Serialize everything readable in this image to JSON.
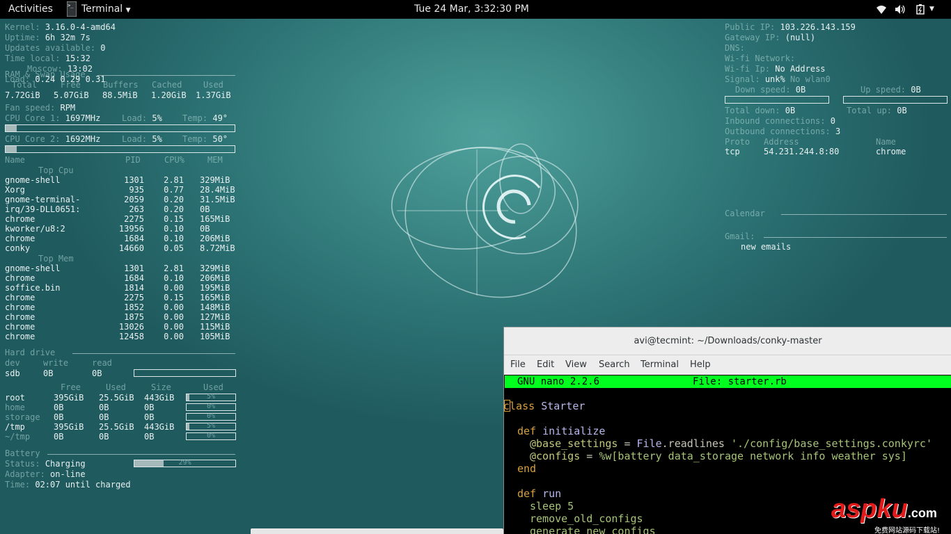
{
  "topbar": {
    "activities": "Activities",
    "app": "Terminal",
    "app_icon_text": ">_",
    "clock": "Tue 24 Mar,  3:32:30 PM",
    "icons": [
      "wifi-icon",
      "volume-icon",
      "battery-icon",
      "chevron-down-icon"
    ]
  },
  "left": {
    "kernel_label": "Kernel:",
    "kernel": "3.16.0-4-amd64",
    "uptime_label": "Uptime:",
    "uptime": "6h 32m 7s",
    "updates_label": "Updates available:",
    "updates": "0",
    "timelocal_label": "Time local:",
    "timelocal": "15:32",
    "moscow_label": "Moscow:",
    "moscow": "13:02",
    "ram_label": "RAM & Swap Usage",
    "load_label": "Load:",
    "load": "0.24 0.29 0.31",
    "mem_headers": [
      "Total",
      "Free",
      "Buffers",
      "Cached",
      "Used"
    ],
    "mem_values": [
      "7.72GiB",
      "5.07GiB",
      "88.5MiB",
      "1.20GiB",
      "1.37GiB"
    ],
    "fan_label": "Fan speed:",
    "fan": "RPM",
    "cpu1_label": "CPU Core 1:",
    "cpu1": "1697MHz",
    "cpu1_load_label": "Load:",
    "cpu1_load": "5%",
    "cpu1_temp_label": "Temp:",
    "cpu1_temp": "49°",
    "cpu2_label": "CPU Core 2:",
    "cpu2": "1692MHz",
    "cpu2_load_label": "Load:",
    "cpu2_load": "5%",
    "cpu2_temp_label": "Temp:",
    "cpu2_temp": "50°",
    "cpu1_fill": 0.05,
    "cpu2_fill": 0.05,
    "proc_headers": [
      "Name",
      "PID",
      "CPU%",
      "MEM"
    ],
    "top_cpu_label": "Top Cpu",
    "top_cpu": [
      [
        "gnome-shell",
        "1301",
        "2.81",
        "329MiB"
      ],
      [
        "Xorg",
        "935",
        "0.77",
        "28.4MiB"
      ],
      [
        "gnome-terminal-",
        "2059",
        "0.20",
        "31.5MiB"
      ],
      [
        "irq/39-DLL0651:",
        "263",
        "0.20",
        "0B"
      ],
      [
        "chrome",
        "2275",
        "0.15",
        "165MiB"
      ],
      [
        "kworker/u8:2",
        "13956",
        "0.10",
        "0B"
      ],
      [
        "chrome",
        "1684",
        "0.10",
        "206MiB"
      ],
      [
        "conky",
        "14660",
        "0.05",
        "8.72MiB"
      ]
    ],
    "top_mem_label": "Top Mem",
    "top_mem": [
      [
        "gnome-shell",
        "1301",
        "2.81",
        "329MiB"
      ],
      [
        "chrome",
        "1684",
        "0.10",
        "206MiB"
      ],
      [
        "soffice.bin",
        "1814",
        "0.00",
        "195MiB"
      ],
      [
        "chrome",
        "2275",
        "0.15",
        "165MiB"
      ],
      [
        "chrome",
        "1852",
        "0.00",
        "148MiB"
      ],
      [
        "chrome",
        "1875",
        "0.00",
        "127MiB"
      ],
      [
        "chrome",
        "13026",
        "0.00",
        "115MiB"
      ],
      [
        "chrome",
        "12458",
        "0.00",
        "105MiB"
      ]
    ],
    "hd_label": "Hard drive",
    "hd_headers": [
      "dev",
      "write",
      "read"
    ],
    "hd_values": [
      "sdb",
      "0B",
      "0B"
    ],
    "fs_headers": [
      "Free",
      "Used",
      "Size",
      "Used"
    ],
    "fs_rows": [
      {
        "name": "root",
        "free": "395GiB",
        "used": "25.5GiB",
        "size": "443GiB",
        "pct": "5%",
        "fill": 0.05
      },
      {
        "name": "home",
        "free": "0B",
        "used": "0B",
        "size": "0B",
        "pct": "0%",
        "fill": 0
      },
      {
        "name": "storage",
        "free": "0B",
        "used": "0B",
        "size": "0B",
        "pct": "0%",
        "fill": 0
      },
      {
        "name": "/tmp",
        "free": "395GiB",
        "used": "25.5GiB",
        "size": "443GiB",
        "pct": "5%",
        "fill": 0.05
      },
      {
        "name": "~/tmp",
        "free": "0B",
        "used": "0B",
        "size": "0B",
        "pct": "0%",
        "fill": 0
      }
    ],
    "battery_label": "Battery",
    "status_label": "Status:",
    "status": "Charging",
    "battery_pct": "29%",
    "battery_fill": 0.29,
    "adapter_label": "Adapter:",
    "adapter": "on-line",
    "time_label": "Time:",
    "time": "02:07 until charged"
  },
  "right": {
    "public_ip_label": "Public IP:",
    "public_ip": "103.226.143.159",
    "gateway_label": "Gateway IP:",
    "gateway": "(null)",
    "dns_label": "DNS:",
    "wifi_label": "Wi-fi Network:",
    "wifi_ip_label": "Wi-fi Ip:",
    "wifi_ip": "No Address",
    "signal_label": "Signal:",
    "signal": "unk%",
    "signal_dev": "No wlan0",
    "down_label": "Down speed:",
    "down": "0B",
    "up_label": "Up speed:",
    "up": "0B",
    "total_down_label": "Total down:",
    "total_down": "0B",
    "total_up_label": "Total up:",
    "total_up": "0B",
    "inbound_label": "Inbound connections:",
    "inbound": "0",
    "outbound_label": "Outbound connections:",
    "outbound": "3",
    "conn_headers": [
      "Proto",
      "Address",
      "Name"
    ],
    "conn_row": [
      "tcp",
      "54.231.244.8:80",
      "chrome"
    ],
    "calendar_label": "Calendar",
    "gmail_label": "Gmail:",
    "gmail_value": "new emails"
  },
  "terminal": {
    "title": "avi@tecmint: ~/Downloads/conky-master",
    "menu": [
      "File",
      "Edit",
      "View",
      "Search",
      "Terminal",
      "Help"
    ],
    "nano_version": "GNU nano 2.2.6",
    "nano_file": "File: starter.rb",
    "code": {
      "l1_kw": "class",
      "l1_name": "Starter",
      "l3_kw": "def",
      "l3_name": "initialize",
      "l4_ivar": "@base_settings",
      "l4_op": " = ",
      "l4_cls": "File",
      "l4_call": ".readlines ",
      "l4_str": "'./config/base_settings.conkyrc'",
      "l5_ivar": "@configs",
      "l5_op": " = ",
      "l5_str": "%w[battery data_storage network info weather sys]",
      "l6_kw": "end",
      "l8_kw": "def",
      "l8_name": "run",
      "l9": "sleep 5",
      "l10": "remove_old_configs",
      "l11": "generate_new_configs"
    }
  },
  "watermark": {
    "main": "aspku",
    "tld": ".com",
    "sub": "免费网站源码下载站!"
  },
  "colors": {
    "topbar": "#000000",
    "nano_bar": "#00ff1e",
    "watermark": "#e01b1b"
  }
}
